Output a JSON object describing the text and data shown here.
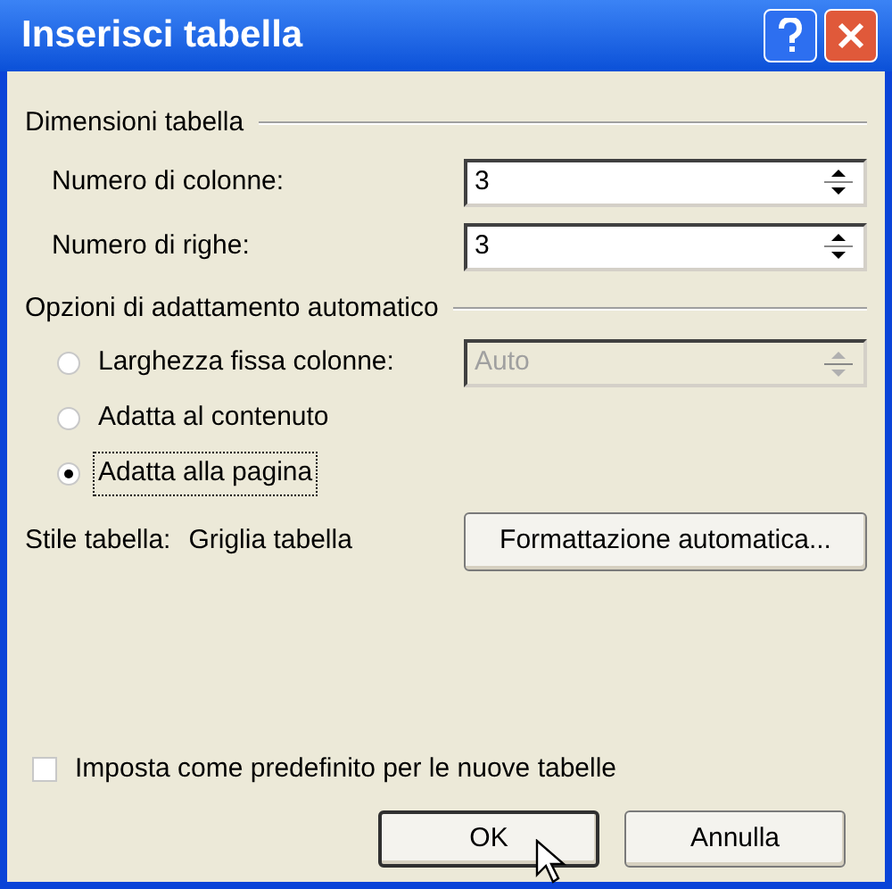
{
  "window": {
    "title": "Inserisci tabella"
  },
  "size_group": {
    "title": "Dimensioni tabella",
    "fields": [
      {
        "label": "Numero di colonne:",
        "value": "3"
      },
      {
        "label": "Numero di righe:",
        "value": "3"
      }
    ]
  },
  "autofit_group": {
    "title": "Opzioni di adattamento automatico",
    "options": [
      {
        "label": "Larghezza fissa colonne:",
        "selected": false,
        "focused": false
      },
      {
        "label": "Adatta al contenuto",
        "selected": false,
        "focused": false
      },
      {
        "label": "Adatta alla pagina",
        "selected": true,
        "focused": true
      }
    ],
    "width_field": {
      "value": "Auto",
      "disabled": true
    }
  },
  "style": {
    "label": "Stile tabella:",
    "value": "Griglia tabella",
    "button": "Formattazione automatica..."
  },
  "default_checkbox": {
    "label": "Imposta come predefinito per le nuove tabelle",
    "checked": false
  },
  "buttons": [
    {
      "label": "OK",
      "default": true
    },
    {
      "label": "Annulla",
      "default": false
    }
  ]
}
